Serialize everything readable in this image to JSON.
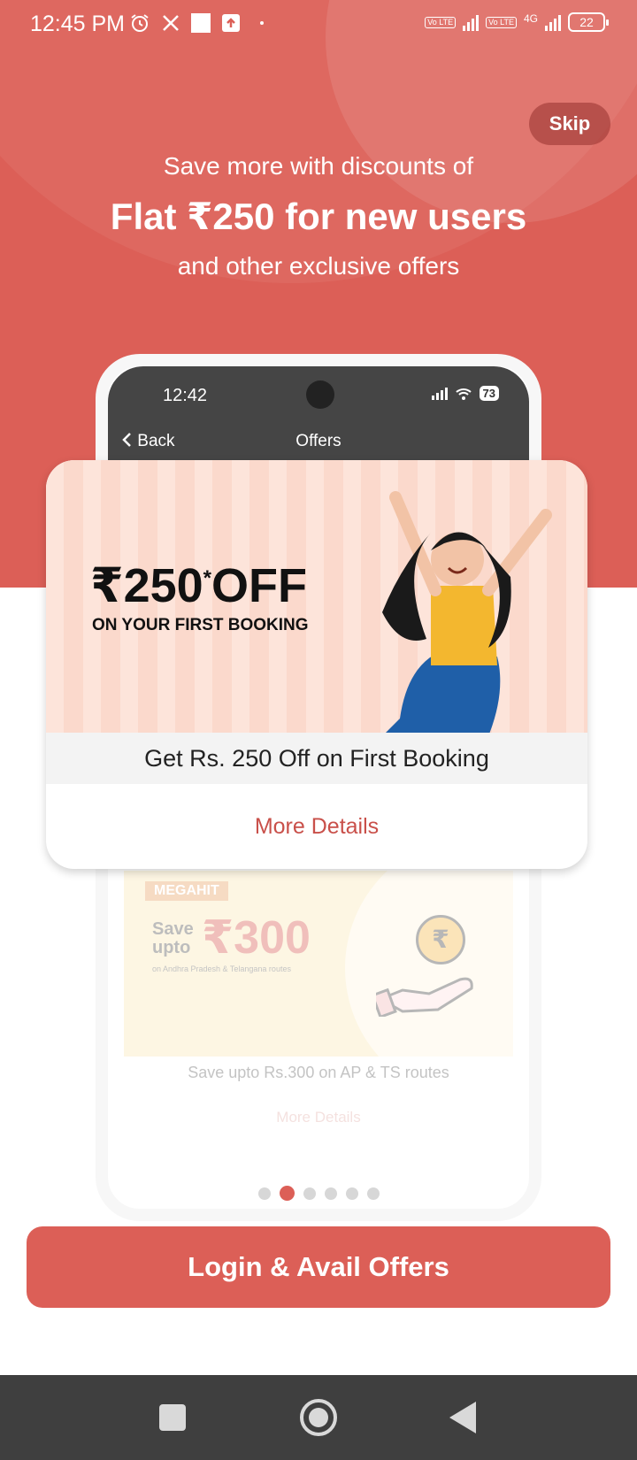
{
  "status_bar": {
    "time": "12:45 PM",
    "volte_label": "Vo LTE",
    "network_label": "4G",
    "battery": "22"
  },
  "skip_label": "Skip",
  "hero": {
    "line1": "Save more with discounts of",
    "line2": "Flat ₹250 for new users",
    "line3": "and other exclusive offers"
  },
  "phone": {
    "time": "12:42",
    "battery": "73",
    "back_label": "Back",
    "title": "Offers"
  },
  "offer_card": {
    "amount": "₹250",
    "amount_mark": "*",
    "amount_suffix": "OFF",
    "subtitle": "ON YOUR FIRST BOOKING",
    "caption": "Get Rs. 250 Off on First Booking",
    "more_details": "More Details"
  },
  "next_card": {
    "tag": "MEGAHIT",
    "save_text": "Save upto",
    "amount": "₹300",
    "routes": "on Andhra Pradesh & Telangana routes",
    "coin": "₹",
    "caption": "Save upto Rs.300 on AP & TS routes",
    "more_details": "More Details"
  },
  "carousel": {
    "count": 6,
    "active_index": 1
  },
  "cta_label": "Login & Avail Offers",
  "colors": {
    "brand": "#dc5f57",
    "nav_bar": "#3f3f3f"
  }
}
